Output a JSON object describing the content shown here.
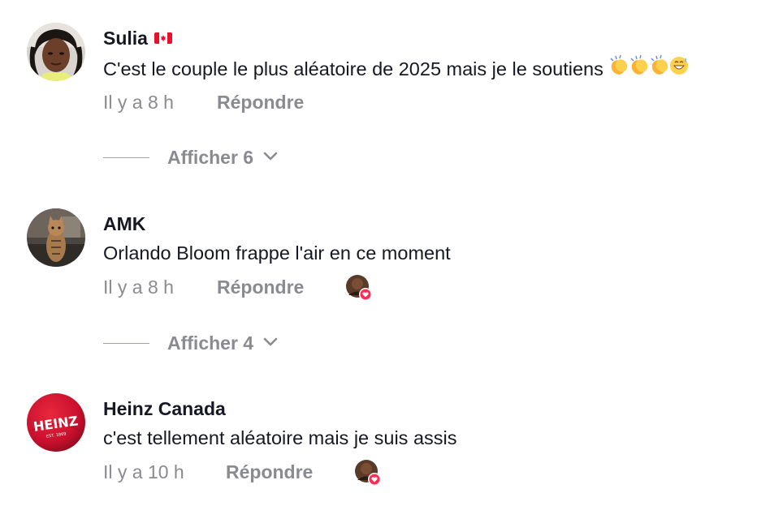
{
  "comments": [
    {
      "username": "Sulia",
      "flag_icon": "canada-flag-icon",
      "text": "C'est le couple le plus aléatoire de 2025 mais je le soutiens",
      "emoji_icons": [
        "clapping-hands-icon",
        "clapping-hands-icon",
        "clapping-hands-icon",
        "grinning-sweat-icon"
      ],
      "time": "Il y a 8 h",
      "reply_label": "Répondre",
      "creator_liked": false,
      "view_replies_label": "Afficher 6"
    },
    {
      "username": "AMK",
      "text": "Orlando Bloom frappe l'air en ce moment",
      "time": "Il y a 8 h",
      "reply_label": "Répondre",
      "creator_liked": true,
      "view_replies_label": "Afficher 4"
    },
    {
      "username": "Heinz Canada",
      "text": "c'est tellement aléatoire mais je suis assis",
      "time": "Il y a 10 h",
      "reply_label": "Répondre",
      "creator_liked": true,
      "avatar_logo_text": "HEINZ",
      "avatar_logo_subtext": "EST. 1869"
    }
  ],
  "colors": {
    "primary_text": "#161823",
    "secondary_text": "#8a8b91",
    "like_badge": "#fe2c55",
    "heinz_red": "#c8102e"
  }
}
